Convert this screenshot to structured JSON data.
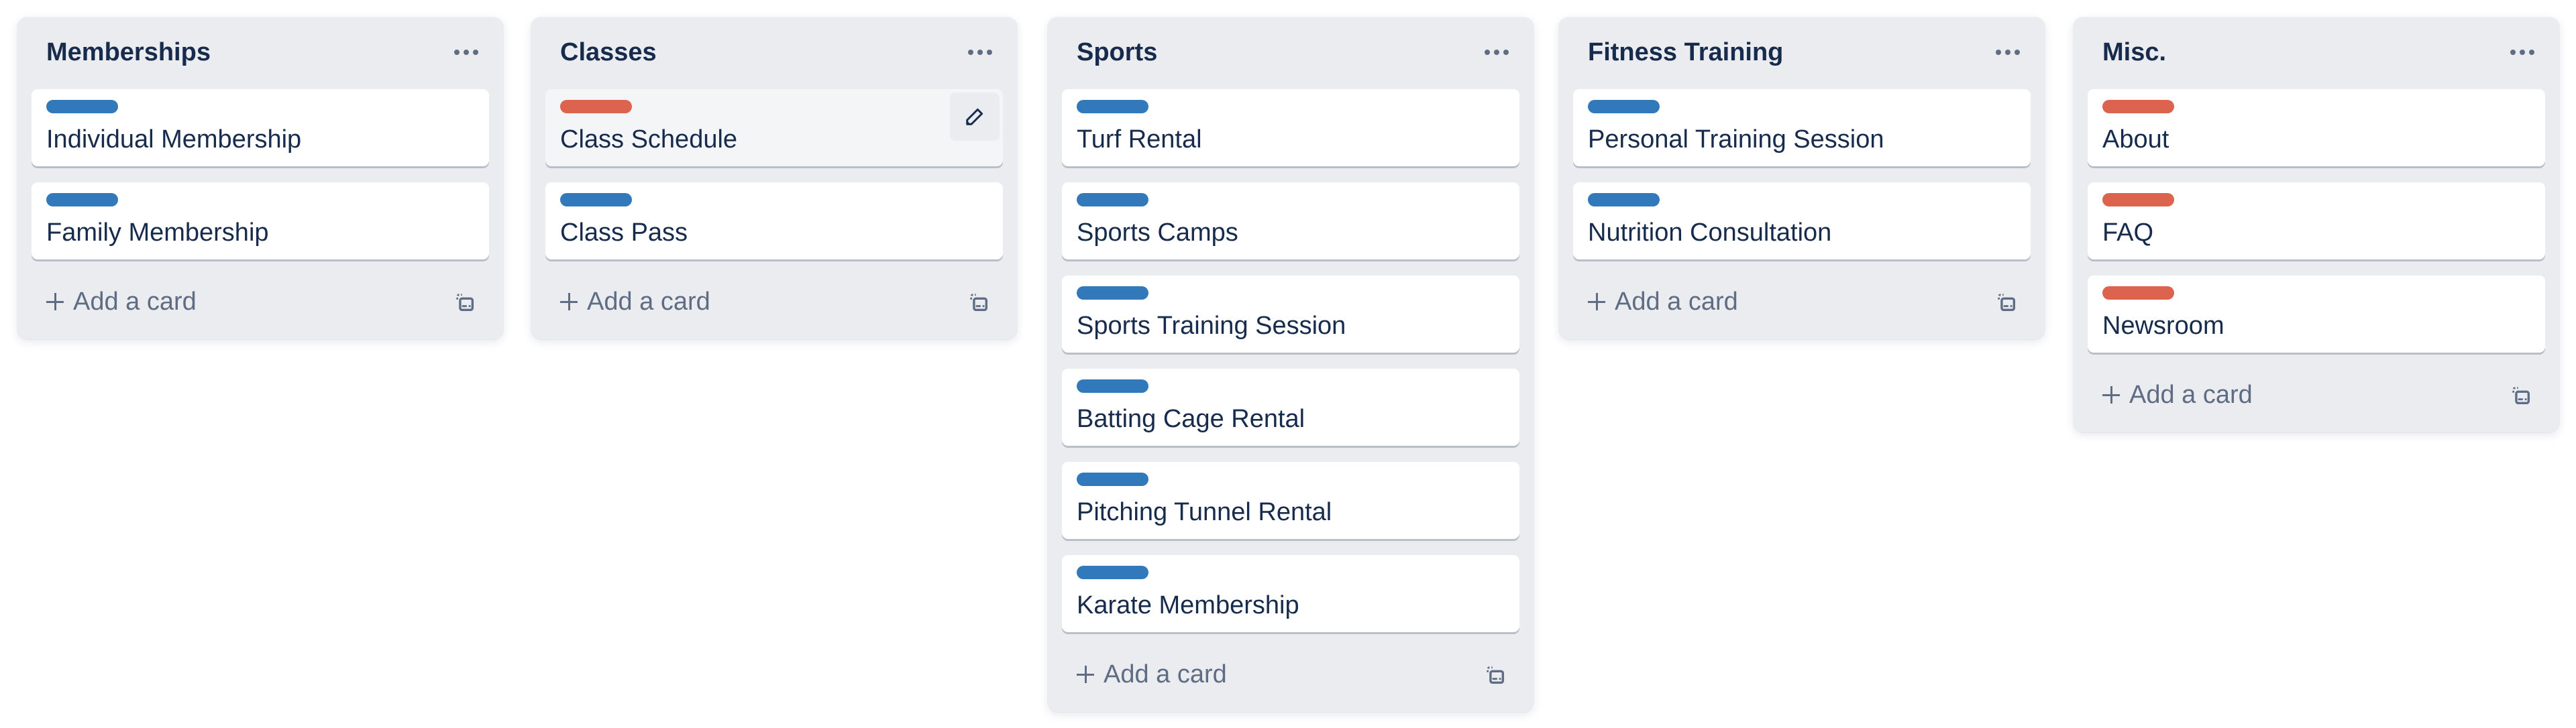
{
  "colors": {
    "list_bg": "#ebecf0",
    "card_bg": "#ffffff",
    "text": "#172b4d",
    "muted_text": "#5e6c84",
    "label_blue": "#3179ba",
    "label_red": "#dc634d"
  },
  "lists": [
    {
      "title": "Memberships",
      "menu_icon": "more-horizontal-icon",
      "cards": [
        {
          "title": "Individual Membership",
          "label_color": "blue"
        },
        {
          "title": "Family Membership",
          "label_color": "blue"
        }
      ],
      "add_card_label": "Add a card",
      "template_icon": "card-template-icon"
    },
    {
      "title": "Classes",
      "menu_icon": "more-horizontal-icon",
      "cards": [
        {
          "title": "Class Schedule",
          "label_color": "red",
          "hovered": true,
          "edit_icon": "pencil-icon"
        },
        {
          "title": "Class Pass",
          "label_color": "blue"
        }
      ],
      "add_card_label": "Add a card",
      "template_icon": "card-template-icon"
    },
    {
      "title": "Sports",
      "menu_icon": "more-horizontal-icon",
      "cards": [
        {
          "title": "Turf Rental",
          "label_color": "blue"
        },
        {
          "title": "Sports Camps",
          "label_color": "blue"
        },
        {
          "title": "Sports Training Session",
          "label_color": "blue"
        },
        {
          "title": "Batting Cage Rental",
          "label_color": "blue"
        },
        {
          "title": "Pitching Tunnel Rental",
          "label_color": "blue"
        },
        {
          "title": "Karate Membership",
          "label_color": "blue"
        }
      ],
      "add_card_label": "Add a card",
      "template_icon": "card-template-icon"
    },
    {
      "title": "Fitness Training",
      "menu_icon": "more-horizontal-icon",
      "cards": [
        {
          "title": "Personal Training Session",
          "label_color": "blue"
        },
        {
          "title": "Nutrition Consultation",
          "label_color": "blue"
        }
      ],
      "add_card_label": "Add a card",
      "template_icon": "card-template-icon"
    },
    {
      "title": "Misc.",
      "menu_icon": "more-horizontal-icon",
      "cards": [
        {
          "title": "About",
          "label_color": "red"
        },
        {
          "title": "FAQ",
          "label_color": "red"
        },
        {
          "title": "Newsroom",
          "label_color": "red"
        }
      ],
      "add_card_label": "Add a card",
      "template_icon": "card-template-icon"
    }
  ]
}
